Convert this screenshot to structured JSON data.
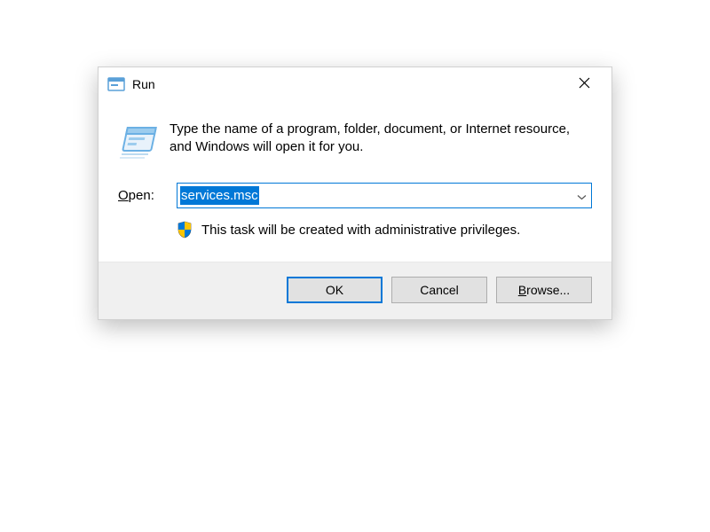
{
  "titlebar": {
    "title": "Run"
  },
  "content": {
    "instruction": "Type the name of a program, folder, document, or Internet resource, and Windows will open it for you.",
    "open_label_prefix": "O",
    "open_label_rest": "pen:",
    "input_value": "services.msc",
    "admin_notice": "This task will be created with administrative privileges."
  },
  "buttons": {
    "ok": "OK",
    "cancel": "Cancel",
    "browse_prefix": "B",
    "browse_rest": "rowse..."
  }
}
